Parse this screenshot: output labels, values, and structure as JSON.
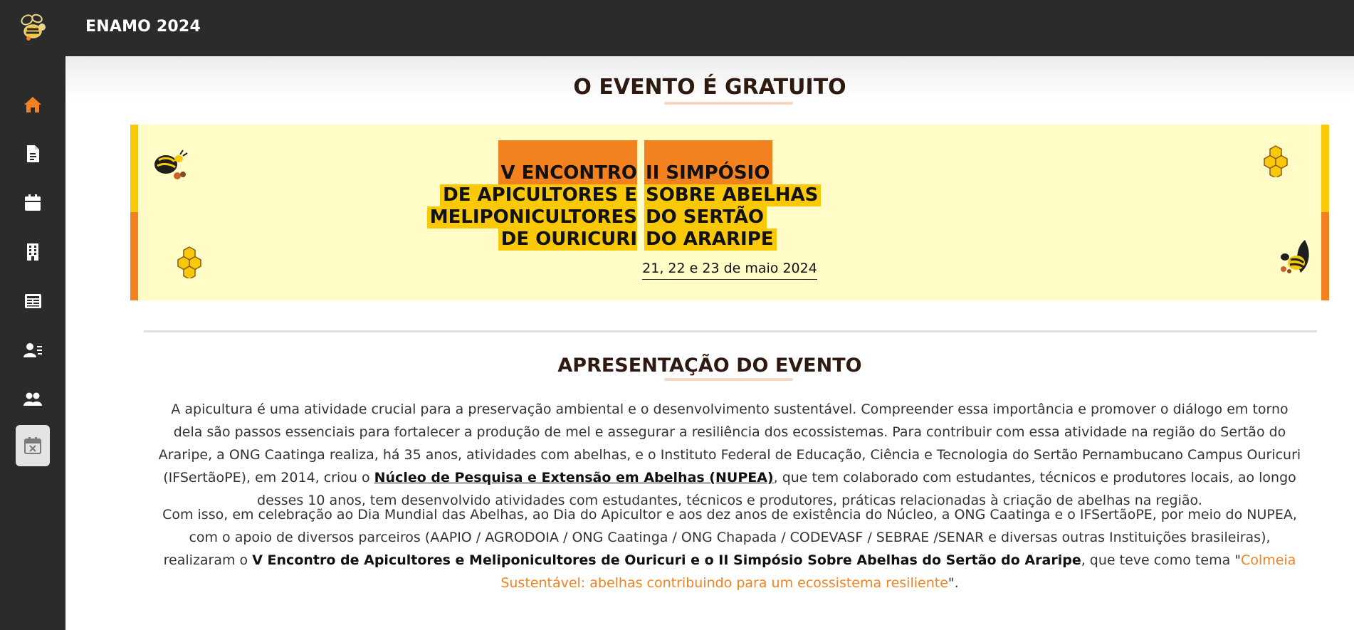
{
  "header": {
    "app_title": "ENAMO 2024"
  },
  "colors": {
    "topbar": "#2b2b2b",
    "accent_orange": "#f28220",
    "accent_yellow": "#f9c908",
    "banner_bg": "#fffcc7",
    "heading": "#2f1a12"
  },
  "sidebar": {
    "items": [
      {
        "icon": "home-icon",
        "active": true
      },
      {
        "icon": "document-icon",
        "active": false
      },
      {
        "icon": "calendar-icon",
        "active": false
      },
      {
        "icon": "building-icon",
        "active": false
      },
      {
        "icon": "newspaper-icon",
        "active": false
      },
      {
        "icon": "contact-list-icon",
        "active": false
      },
      {
        "icon": "users-icon",
        "active": false
      },
      {
        "icon": "calendar-x-icon",
        "active": false
      }
    ]
  },
  "main": {
    "free_heading": "O EVENTO É GRATUITO",
    "banner": {
      "left_lines": [
        "V ENCONTRO",
        "DE APICULTORES E",
        "MELIPONICULTORES",
        "DE OURICURI"
      ],
      "right_lines": [
        "II SIMPÓSIO",
        "SOBRE ABELHAS",
        "DO SERTÃO",
        "DO ARARIPE"
      ],
      "dates": "21, 22 e 23 de maio 2024"
    },
    "presentation_heading": "APRESENTAÇÃO DO EVENTO",
    "paragraph1": {
      "before_link": "A apicultura é uma atividade crucial para a preservação ambiental e o desenvolvimento sustentável. Compreender essa importância e promover o diálogo em torno dela são passos essenciais para fortalecer a produção de mel e assegurar a resiliência dos ecossistemas. Para contribuir com essa atividade na região do Sertão do Araripe, a ONG Caatinga realiza, há 35 anos, atividades com abelhas, e o Instituto Federal de Educação, Ciência e Tecnologia do Sertão Pernambucano Campus Ouricuri (IFSertãoPE), em 2014, criou o ",
      "link": "Núcleo de Pesquisa e Extensão em Abelhas (NUPEA)",
      "after_link": ", que tem colaborado com estudantes, técnicos e produtores locais, ao longo desses 10 anos, tem desenvolvido atividades com estudantes, técnicos e produtores, práticas relacionadas à criação de abelhas na região."
    },
    "paragraph2": {
      "text1": "Com isso, em celebração ao Dia Mundial das Abelhas, ao Dia do Apicultor e aos dez anos de existência do Núcleo, a ONG Caatinga e o IFSertãoPE, por meio do NUPEA, com o apoio de diversos parceiros (AAPIO / AGRODOIA / ONG Caatinga / ONG Chapada / CODEVASF / SEBRAE /SENAR e diversas outras Instituições brasileiras), realizaram o ",
      "bold": "V Encontro de Apicultores e Meliponicultores de Ouricuri e o II Simpósio Sobre Abelhas do Sertão do Araripe",
      "text2": ", que teve como tema \"",
      "theme": "Colmeia Sustentável: abelhas contribuindo para um ecossistema resiliente",
      "text3": "\"."
    }
  }
}
